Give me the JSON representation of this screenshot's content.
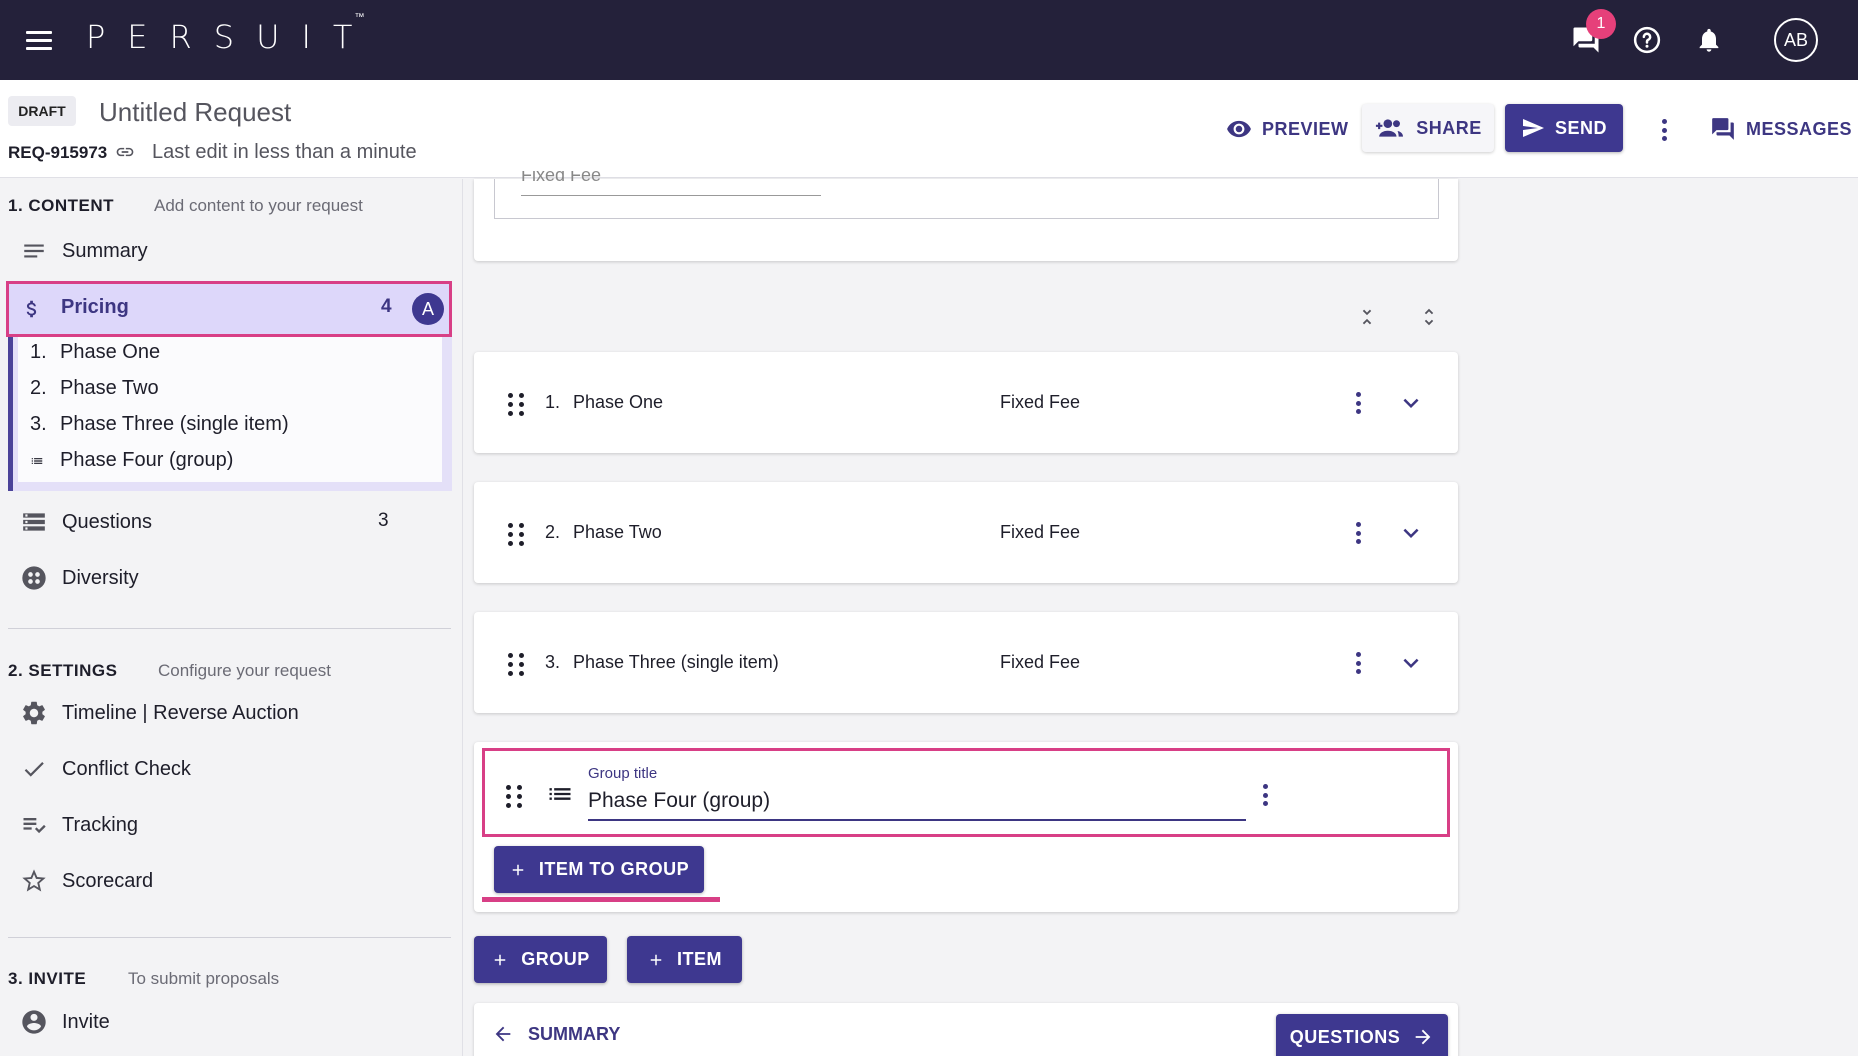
{
  "topbar": {
    "brand": "PERSUIT",
    "trademark": "™",
    "messages_badge": "1",
    "avatar_initials": "AB"
  },
  "header": {
    "status_chip": "DRAFT",
    "title": "Untitled Request",
    "request_id": "REQ-915973",
    "last_edit": "Last edit in less than a minute",
    "preview_label": "PREVIEW",
    "share_label": "SHARE",
    "send_label": "SEND",
    "messages_label": "MESSAGES"
  },
  "sidebar": {
    "content": {
      "heading": "1. CONTENT",
      "subtitle": "Add content to your request",
      "items": [
        {
          "label": "Summary",
          "icon": "notes-icon"
        },
        {
          "label": "Pricing",
          "icon": "dollar-icon",
          "count": "4",
          "badge": "A"
        },
        {
          "label": "Questions",
          "icon": "storage-icon",
          "count": "3"
        },
        {
          "label": "Diversity",
          "icon": "diversity-icon"
        }
      ],
      "pricing_subitems": [
        {
          "num": "1.",
          "label": "Phase One"
        },
        {
          "num": "2.",
          "label": "Phase Two"
        },
        {
          "num": "3.",
          "label": "Phase Three (single item)"
        },
        {
          "num": "",
          "label": "Phase Four (group)"
        }
      ]
    },
    "settings": {
      "heading": "2. SETTINGS",
      "subtitle": "Configure your request",
      "items": [
        {
          "label": "Timeline | Reverse Auction",
          "icon": "gear-icon"
        },
        {
          "label": "Conflict Check",
          "icon": "check-icon"
        },
        {
          "label": "Tracking",
          "icon": "playlist-check-icon"
        },
        {
          "label": "Scorecard",
          "icon": "star-icon"
        }
      ]
    },
    "invite": {
      "heading": "3. INVITE",
      "subtitle": "To submit proposals",
      "items": [
        {
          "label": "Invite",
          "icon": "account-circle-icon"
        }
      ]
    }
  },
  "main": {
    "top_card_partial_text": "Fixed Fee",
    "pricing_items": [
      {
        "num": "1.",
        "name": "Phase One",
        "type": "Fixed Fee"
      },
      {
        "num": "2.",
        "name": "Phase Two",
        "type": "Fixed Fee"
      },
      {
        "num": "3.",
        "name": "Phase Three (single item)",
        "type": "Fixed Fee"
      }
    ],
    "group": {
      "field_label": "Group title",
      "field_value": "Phase Four (group)",
      "add_item_label": "ITEM TO GROUP"
    },
    "add_group_label": "GROUP",
    "add_item_label": "ITEM",
    "nav_back_label": "SUMMARY",
    "nav_next_label": "QUESTIONS"
  },
  "colors": {
    "topbar": "#24213a",
    "primary": "#3e3890",
    "highlight": "#d83f86",
    "badge": "#e6407a"
  }
}
